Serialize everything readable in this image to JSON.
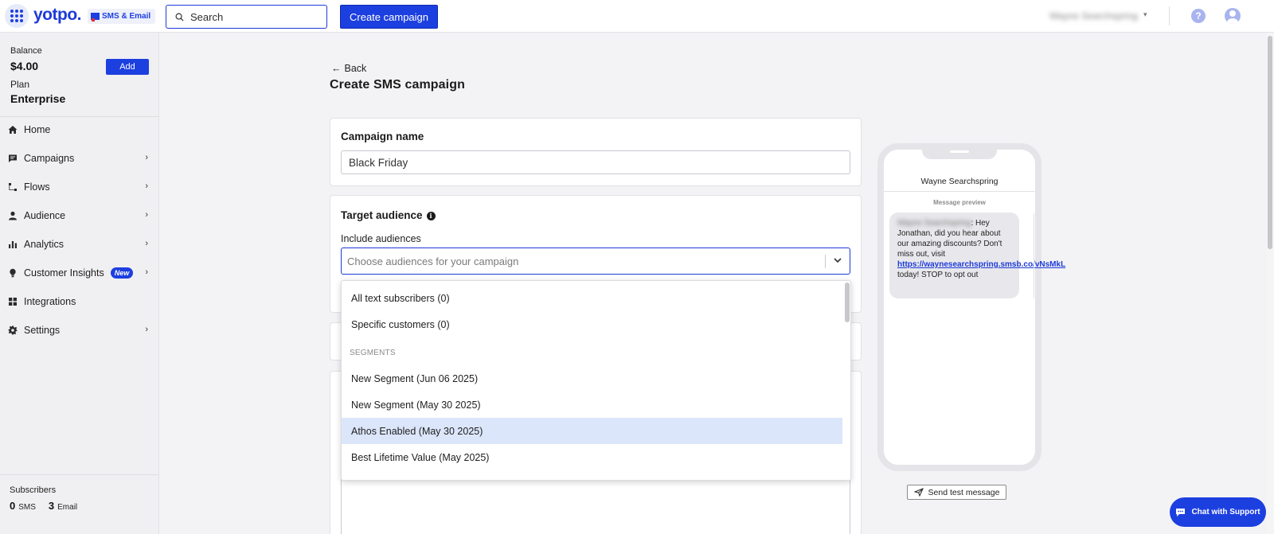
{
  "topbar": {
    "logo": "yotpo.",
    "product": "SMS & Email",
    "search_label": "Search",
    "create_campaign": "Create campaign",
    "user_name": "Wayne Searchspring",
    "help": "?"
  },
  "sidebar": {
    "balance_label": "Balance",
    "balance_value": "$4.00",
    "add_label": "Add",
    "plan_label": "Plan",
    "plan_value": "Enterprise",
    "items": [
      {
        "label": "Home",
        "icon": "home-icon",
        "chevron": false
      },
      {
        "label": "Campaigns",
        "icon": "campaign-icon",
        "chevron": true
      },
      {
        "label": "Flows",
        "icon": "flow-icon",
        "chevron": true
      },
      {
        "label": "Audience",
        "icon": "person-icon",
        "chevron": true
      },
      {
        "label": "Analytics",
        "icon": "bar-chart-icon",
        "chevron": true
      },
      {
        "label": "Customer Insights",
        "icon": "lightbulb-icon",
        "chevron": true,
        "badge": "New"
      },
      {
        "label": "Integrations",
        "icon": "grid-icon",
        "chevron": false
      },
      {
        "label": "Settings",
        "icon": "gear-icon",
        "chevron": true
      }
    ],
    "subscribers_label": "Subscribers",
    "sms_count": "0",
    "sms_label": "SMS",
    "email_count": "3",
    "email_label": "Email"
  },
  "main": {
    "back_label": "Back",
    "page_title": "Create SMS campaign",
    "campaign_name_title": "Campaign name",
    "campaign_name_value": "Black Friday",
    "target_audience_title": "Target audience",
    "include_label": "Include audiences",
    "audience_placeholder": "Choose audiences for your campaign"
  },
  "dropdown": {
    "options": [
      {
        "label": "All text subscribers (0)"
      },
      {
        "label": "Specific customers (0)"
      }
    ],
    "group_label": "SEGMENTS",
    "segments": [
      {
        "label": "New Segment (Jun 06 2025)"
      },
      {
        "label": "New Segment (May 30 2025)"
      },
      {
        "label": "Athos Enabled (May 30 2025)",
        "highlighted": true
      },
      {
        "label": "Best Lifetime Value (May 2025)"
      }
    ]
  },
  "preview": {
    "sender": "Wayne Searchspring",
    "label": "Message preview",
    "blurred_name": "Wayne Searchspring",
    "message_part1": ": Hey Jonathan, did you hear about our amazing discounts? Don't miss out, visit ",
    "link": "https://waynesearchspring.smsb.co/vNsMkL",
    "message_part2": " today! STOP to opt out",
    "send_test": "Send test message"
  },
  "chat": {
    "label": "Chat with Support"
  },
  "colors": {
    "brand": "#1c3fe0",
    "highlight": "#dce6fb"
  }
}
